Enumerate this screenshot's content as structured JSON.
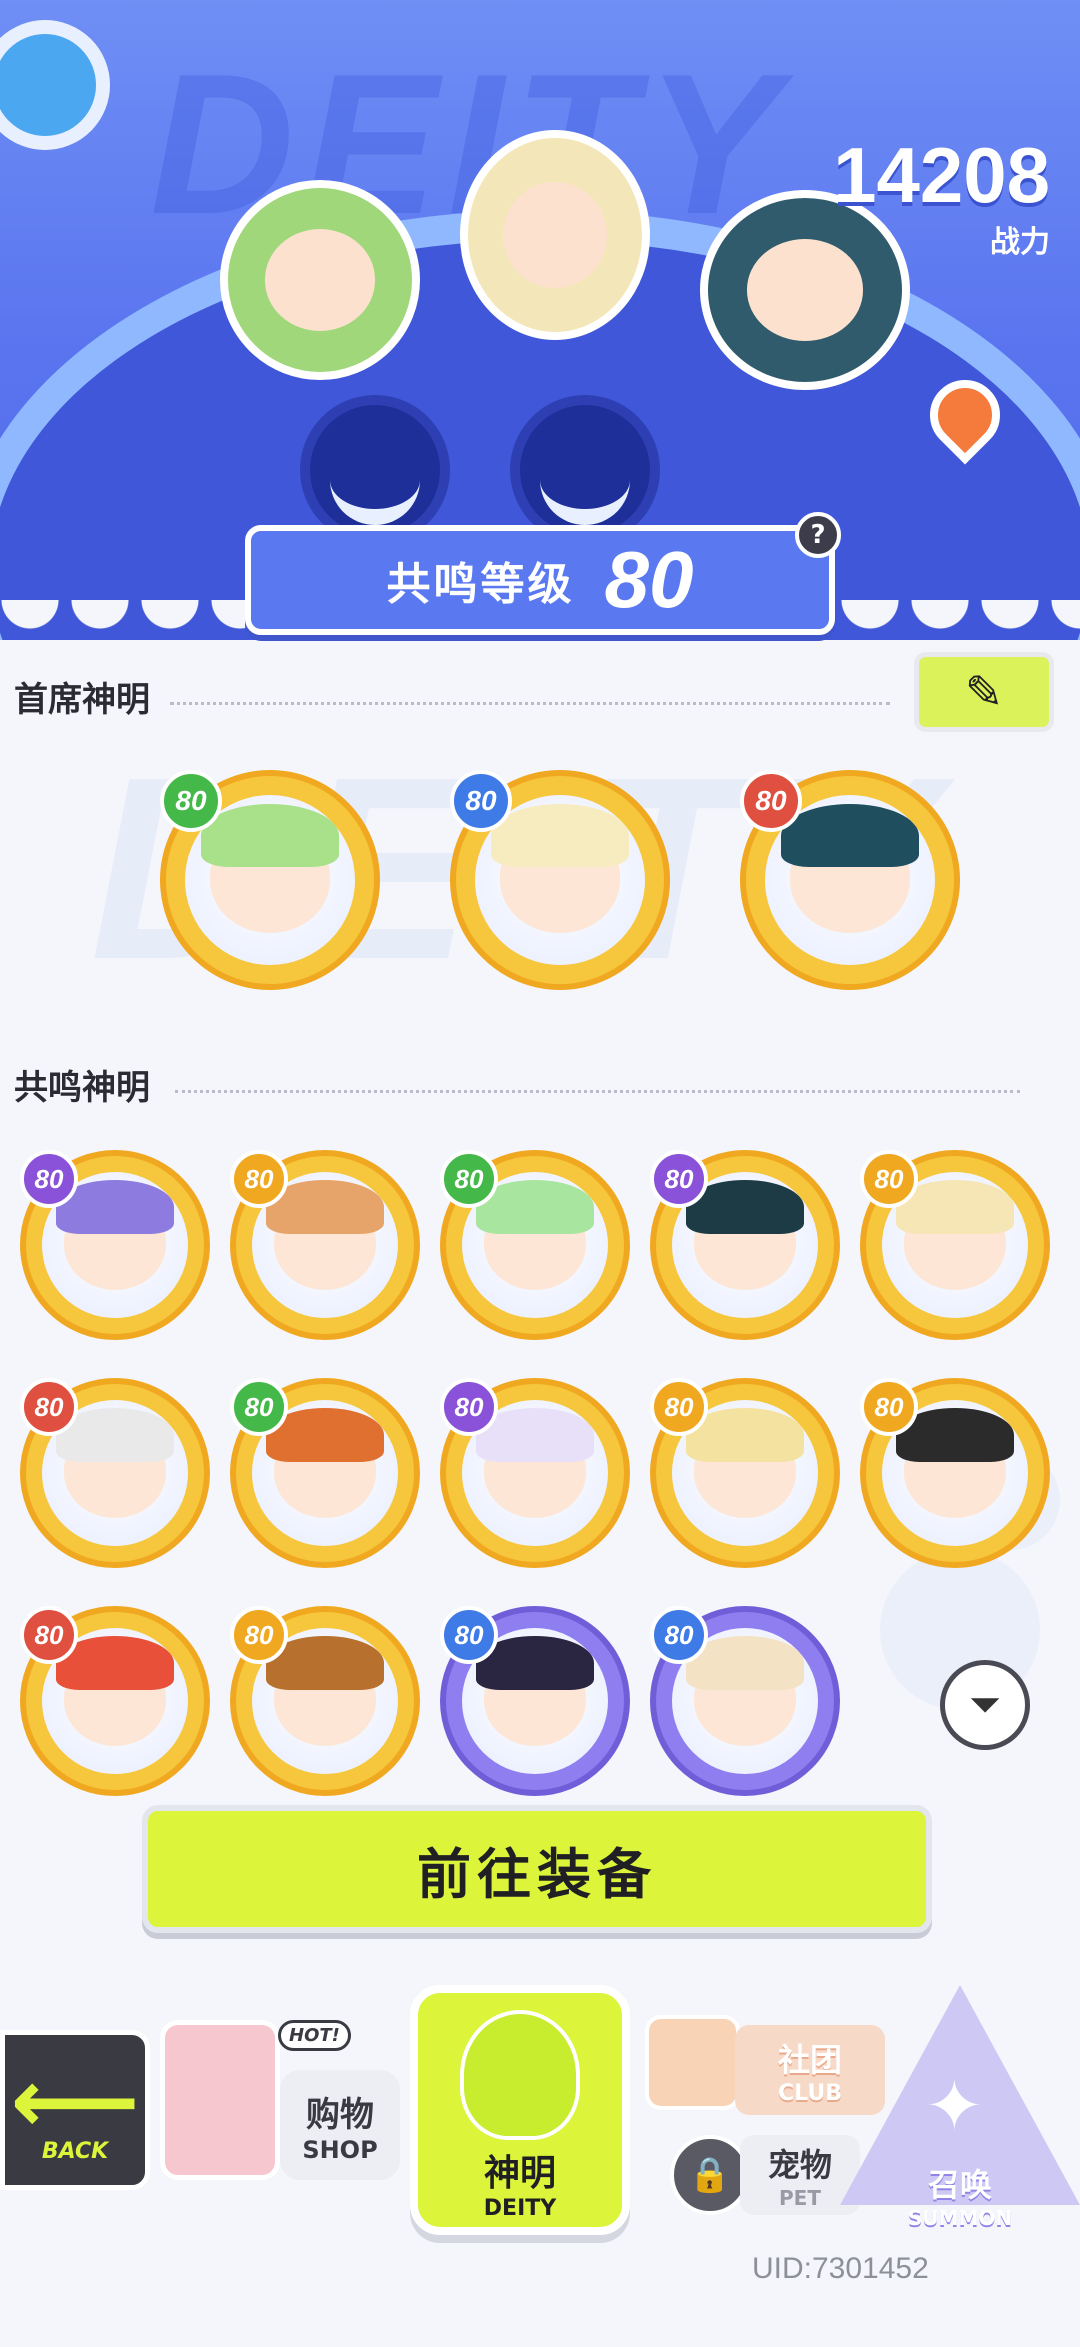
{
  "hero": {
    "bg_word": "DEITY",
    "power_value": "14208",
    "power_label": "战力",
    "resonance_label": "共鸣等级",
    "resonance_level": "80",
    "help_symbol": "?"
  },
  "sections": {
    "head_title": "首席神明",
    "resonance_title": "共鸣神明"
  },
  "edit_button_symbol": "✎",
  "head_deities": [
    {
      "level": "80",
      "badge_color": "#45b84a",
      "hair": "#a9e08a",
      "frame": "gold"
    },
    {
      "level": "80",
      "badge_color": "#3f7be6",
      "hair": "#f7ecc0",
      "frame": "gold"
    },
    {
      "level": "80",
      "badge_color": "#e05040",
      "hair": "#1f4f5f",
      "frame": "gold"
    }
  ],
  "resonance_deities": [
    {
      "level": "80",
      "badge_color": "#8a52d8",
      "hair": "#8e7be0",
      "frame": "gold"
    },
    {
      "level": "80",
      "badge_color": "#f0a820",
      "hair": "#e7a46a",
      "frame": "gold"
    },
    {
      "level": "80",
      "badge_color": "#45b84a",
      "hair": "#a8e6a0",
      "frame": "gold"
    },
    {
      "level": "80",
      "badge_color": "#8a52d8",
      "hair": "#1d3b45",
      "frame": "gold"
    },
    {
      "level": "80",
      "badge_color": "#f0a820",
      "hair": "#f6e6b6",
      "frame": "gold"
    },
    {
      "level": "80",
      "badge_color": "#e05040",
      "hair": "#e9e9ea",
      "frame": "gold"
    },
    {
      "level": "80",
      "badge_color": "#45b84a",
      "hair": "#e07030",
      "frame": "gold"
    },
    {
      "level": "80",
      "badge_color": "#8a52d8",
      "hair": "#e8e0f8",
      "frame": "gold"
    },
    {
      "level": "80",
      "badge_color": "#f0a820",
      "hair": "#f4e3a0",
      "frame": "gold"
    },
    {
      "level": "80",
      "badge_color": "#f0a820",
      "hair": "#2b2b2b",
      "frame": "gold"
    },
    {
      "level": "80",
      "badge_color": "#e05040",
      "hair": "#e8503a",
      "frame": "gold"
    },
    {
      "level": "80",
      "badge_color": "#f0a820",
      "hair": "#b8702e",
      "frame": "gold"
    },
    {
      "level": "80",
      "badge_color": "#3f7be6",
      "hair": "#2a2540",
      "frame": "purple"
    },
    {
      "level": "80",
      "badge_color": "#3f7be6",
      "hair": "#f4e2c4",
      "frame": "purple"
    }
  ],
  "filter_icon": "⏷",
  "equip_button": "前往装备",
  "nav": {
    "back_cn_arrow": "⟵",
    "back_label": "BACK",
    "shop_hot": "HOT!",
    "shop_cn": "购物",
    "shop_en": "SHOP",
    "deity_cn": "神明",
    "deity_en": "DEITY",
    "club_cn": "社团",
    "club_en": "CLUB",
    "pet_cn": "宠物",
    "pet_en": "PET",
    "pet_lock_icon": "🔒",
    "summon_cn": "召唤",
    "summon_en": "SUMMON",
    "summon_star": "✦"
  },
  "uid": "UID:7301452"
}
